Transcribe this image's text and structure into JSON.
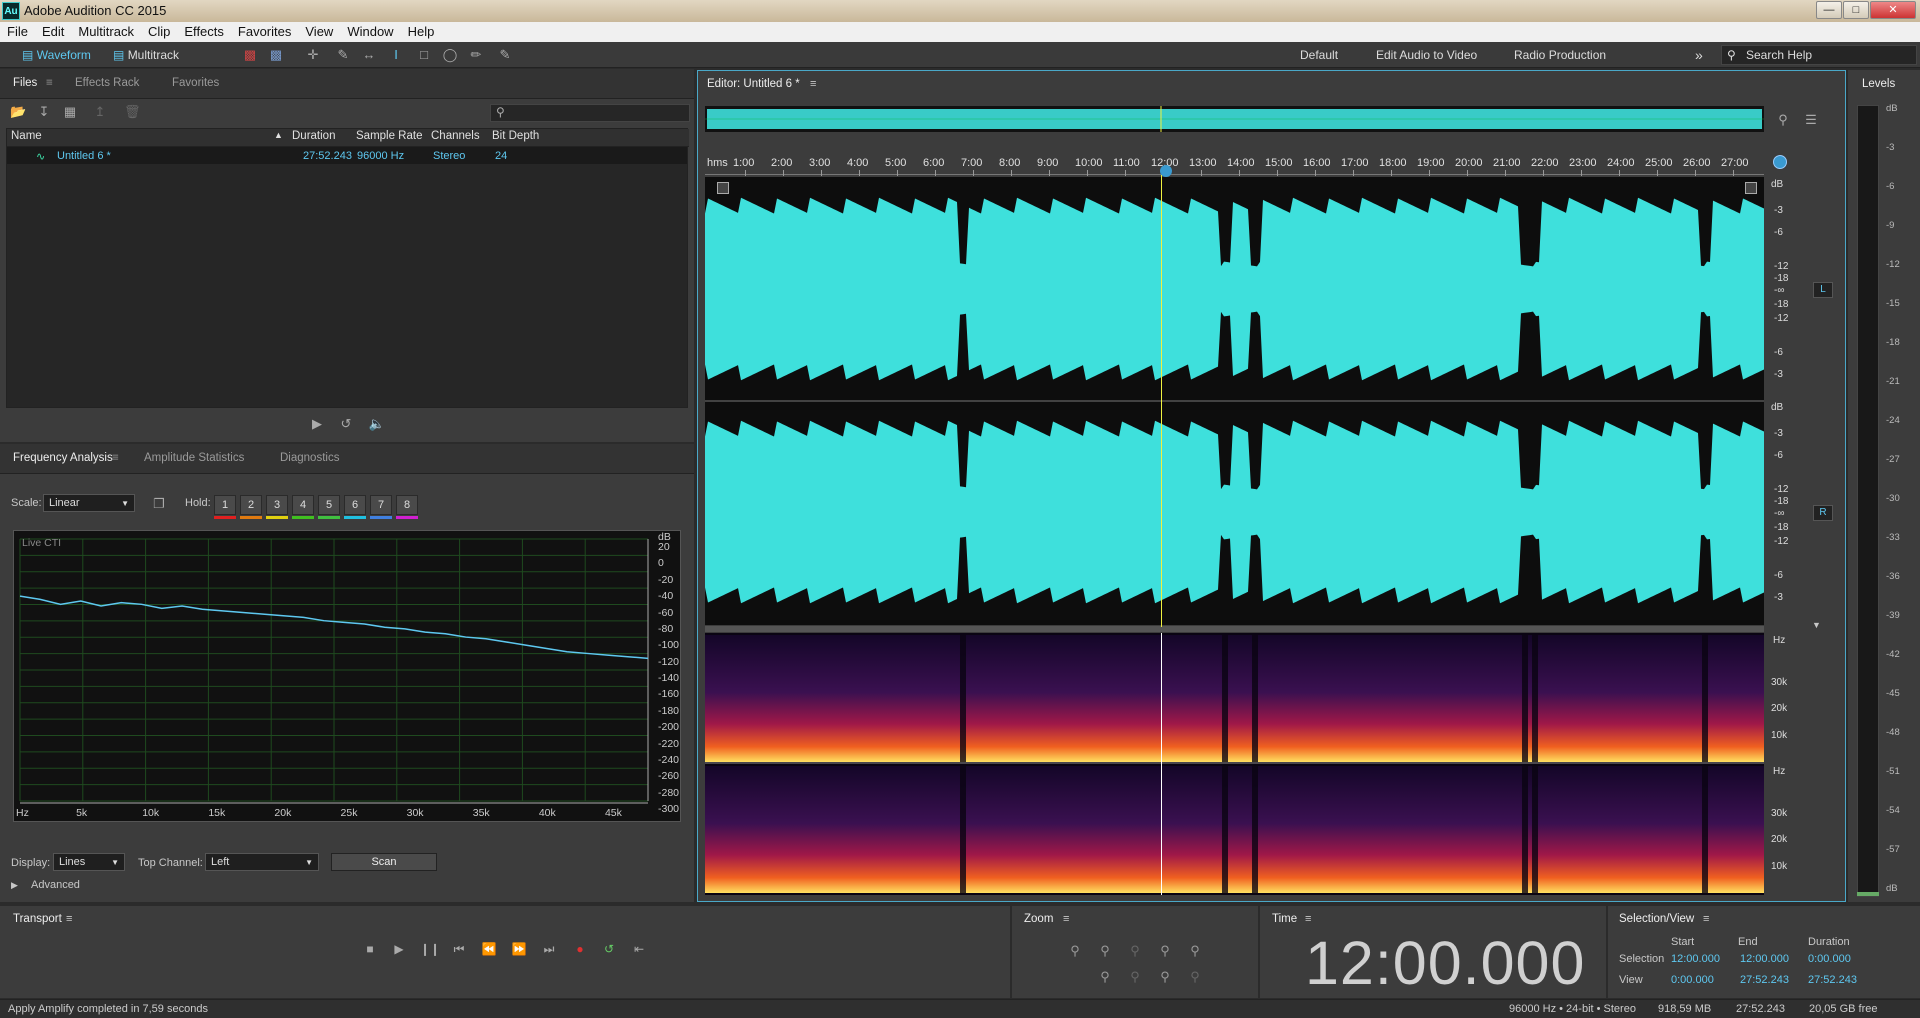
{
  "window": {
    "title": "Adobe Audition CC 2015",
    "logo": "Au"
  },
  "menu": [
    "File",
    "Edit",
    "Multitrack",
    "Clip",
    "Effects",
    "Favorites",
    "View",
    "Window",
    "Help"
  ],
  "toolbar": {
    "waveform": "Waveform",
    "multitrack": "Multitrack",
    "workspaces": [
      "Default",
      "Edit Audio to Video",
      "Radio Production"
    ],
    "search_placeholder": "Search Help"
  },
  "files_panel": {
    "tabs": [
      "Files",
      "Effects Rack",
      "Favorites"
    ],
    "columns": [
      "Name",
      "Duration",
      "Sample Rate",
      "Channels",
      "Bit Depth"
    ],
    "rows": [
      {
        "name": "Untitled 6 *",
        "duration": "27:52.243",
        "sample_rate": "96000 Hz",
        "channels": "Stereo",
        "bit_depth": "24"
      }
    ]
  },
  "analysis_panel": {
    "tabs": [
      "Frequency Analysis",
      "Amplitude Statistics",
      "Diagnostics"
    ],
    "scale_label": "Scale:",
    "scale_value": "Linear",
    "hold_label": "Hold:",
    "hold_buttons": [
      "1",
      "2",
      "3",
      "4",
      "5",
      "6",
      "7",
      "8"
    ],
    "hold_colors": [
      "#e02020",
      "#e07a10",
      "#e0d010",
      "#40c020",
      "#40c040",
      "#20c0e0",
      "#4080e0",
      "#d020d0"
    ],
    "graph_title": "Live CTI",
    "db_unit": "dB",
    "db_ticks": [
      "20",
      "0",
      "-20",
      "-40",
      "-60",
      "-80",
      "-100",
      "-120",
      "-140",
      "-160",
      "-180",
      "-200",
      "-220",
      "-240",
      "-260",
      "-280",
      "-300"
    ],
    "hz_ticks": [
      "Hz",
      "5k",
      "10k",
      "15k",
      "20k",
      "25k",
      "30k",
      "35k",
      "40k",
      "45k"
    ],
    "display_label": "Display:",
    "display_value": "Lines",
    "top_channel_label": "Top Channel:",
    "top_channel_value": "Left",
    "scan_label": "Scan",
    "advanced_label": "Advanced",
    "spectrum_db": [
      -40,
      -44,
      -50,
      -46,
      -52,
      -48,
      -50,
      -55,
      -52,
      -56,
      -58,
      -60,
      -62,
      -64,
      -66,
      -70,
      -72,
      -74,
      -78,
      -80,
      -84,
      -86,
      -90,
      -92,
      -96,
      -100,
      -104,
      -108,
      -110,
      -112,
      -114,
      -116
    ]
  },
  "editor": {
    "title": "Editor: Untitled 6 *",
    "time_unit": "hms",
    "time_ticks": [
      "1:00",
      "2:00",
      "3:00",
      "4:00",
      "5:00",
      "6:00",
      "7:00",
      "8:00",
      "9:00",
      "10:00",
      "11:00",
      "12:00",
      "13:00",
      "14:00",
      "15:00",
      "16:00",
      "17:00",
      "18:00",
      "19:00",
      "20:00",
      "21:00",
      "22:00",
      "23:00",
      "24:00",
      "25:00",
      "26:00",
      "27:00"
    ],
    "db_unit": "dB",
    "db_ticks_top": [
      "-3",
      "-6",
      "-12",
      "-18",
      "-∞",
      "-18",
      "-12",
      "-6",
      "-3"
    ],
    "channel_labels": [
      "L",
      "R"
    ],
    "hz_unit": "Hz",
    "hz_ticks": [
      "30k",
      "20k",
      "10k"
    ],
    "playhead_time": "12:00"
  },
  "levels": {
    "title": "Levels",
    "ticks": [
      "dB",
      "-3",
      "-6",
      "-9",
      "-12",
      "-15",
      "-18",
      "-21",
      "-24",
      "-27",
      "-30",
      "-33",
      "-36",
      "-39",
      "-42",
      "-45",
      "-48",
      "-51",
      "-54",
      "-57",
      "dB"
    ]
  },
  "transport": {
    "title": "Transport"
  },
  "zoom": {
    "title": "Zoom"
  },
  "time_panel": {
    "title": "Time",
    "value": "12:00.000"
  },
  "selection_view": {
    "title": "Selection/View",
    "headers": [
      "Start",
      "End",
      "Duration"
    ],
    "rows": [
      {
        "label": "Selection",
        "start": "12:00.000",
        "end": "12:00.000",
        "duration": "0:00.000"
      },
      {
        "label": "View",
        "start": "0:00.000",
        "end": "27:52.243",
        "duration": "27:52.243"
      }
    ]
  },
  "status": {
    "left": "Apply Amplify completed in 7,59 seconds",
    "format": "96000 Hz • 24-bit • Stereo",
    "size": "918,59 MB",
    "duration": "27:52.243",
    "free": "20,05 GB free"
  },
  "colors": {
    "waveform": "#3ee0dc",
    "accent": "#5ec8f0",
    "playhead": "#f0f040"
  }
}
